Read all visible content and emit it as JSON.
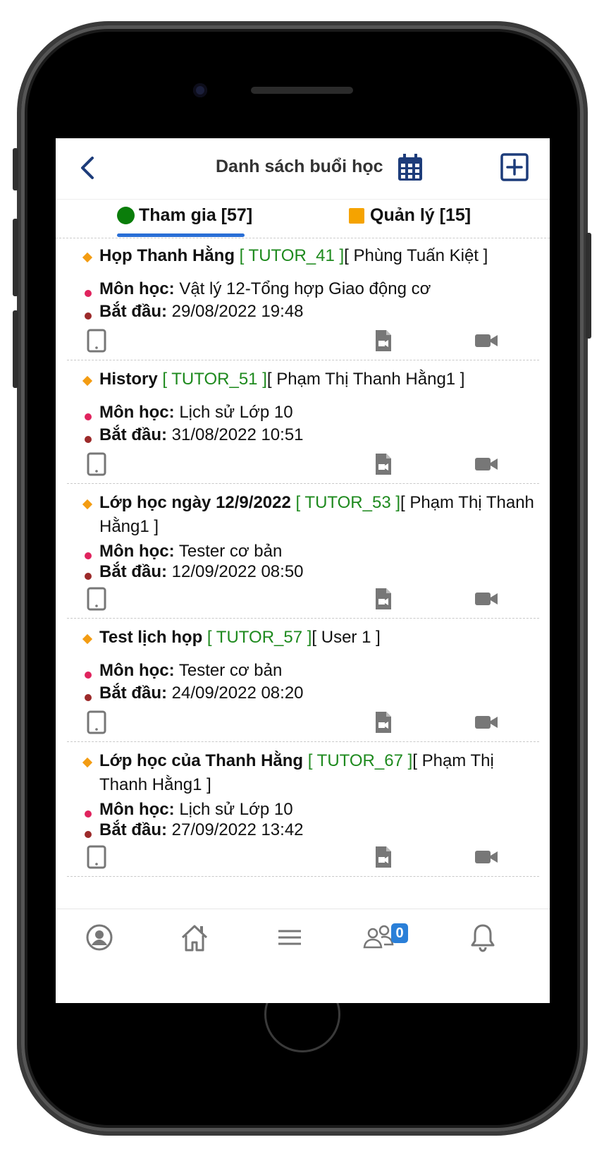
{
  "header": {
    "title": "Danh sách buổi học"
  },
  "tabs": [
    {
      "label": "Tham gia [57]",
      "active": true
    },
    {
      "label": "Quản lý [15]",
      "active": false
    }
  ],
  "colors": {
    "accent": "#2a6fd6",
    "code_green": "#1e8a1e",
    "diamond_orange": "#f39c12"
  },
  "sessions": [
    {
      "name": "Họp Thanh Hằng",
      "code": "[ TUTOR_41 ]",
      "host": "[ Phùng Tuấn Kiệt ]",
      "subject_label": "Môn học:",
      "subject": "Vật lý 12-Tổng hợp Giao động cơ",
      "start_label": "Bắt đầu:",
      "start": "29/08/2022 19:48"
    },
    {
      "name": "History",
      "code": "[ TUTOR_51 ]",
      "host": "[ Phạm Thị Thanh Hằng1 ]",
      "subject_label": "Môn học:",
      "subject": "Lịch sử Lớp 10",
      "start_label": "Bắt đầu:",
      "start": "31/08/2022 10:51"
    },
    {
      "name": "Lớp học ngày 12/9/2022",
      "code": "[ TUTOR_53 ]",
      "host": "[ Phạm Thị Thanh Hằng1 ]",
      "subject_label": "Môn học:",
      "subject": "Tester cơ bản",
      "start_label": "Bắt đầu:",
      "start": "12/09/2022 08:50"
    },
    {
      "name": "Test lịch họp",
      "code": "[ TUTOR_57 ]",
      "host": "[ User 1 ]",
      "subject_label": "Môn học:",
      "subject": "Tester cơ bản",
      "start_label": "Bắt đầu:",
      "start": "24/09/2022 08:20"
    },
    {
      "name": "Lớp học của Thanh Hằng",
      "code": "[ TUTOR_67 ]",
      "host": "[ Phạm Thị Thanh Hằng1 ]",
      "subject_label": "Môn học:",
      "subject": "Lịch sử Lớp 10",
      "start_label": "Bắt đầu:",
      "start": "27/09/2022 13:42"
    }
  ],
  "bottom_nav": {
    "items": [
      "profile-icon",
      "home-icon",
      "menu-icon",
      "group-icon",
      "bell-icon"
    ],
    "group_badge": "0"
  }
}
